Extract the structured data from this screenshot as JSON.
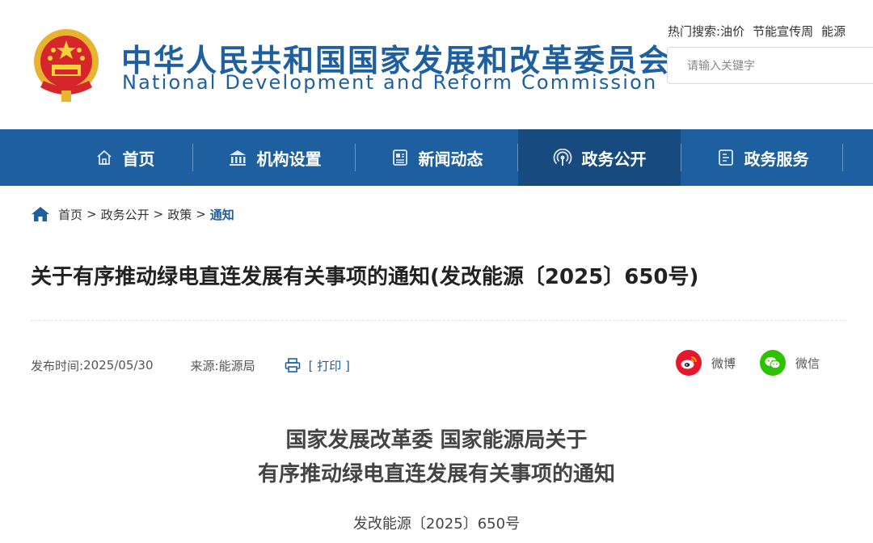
{
  "header": {
    "org_name_cn": "中华人民共和国国家发展和改革委员会",
    "org_name_en": "National Development and Reform Commission",
    "hot_search_label": "热门搜索:",
    "hot_search_terms": [
      "油价",
      "节能宣传周",
      "能源"
    ],
    "search_placeholder": "请输入关键字"
  },
  "nav": {
    "items": [
      {
        "label": "首页",
        "icon": "home-icon"
      },
      {
        "label": "机构设置",
        "icon": "building-icon"
      },
      {
        "label": "新闻动态",
        "icon": "news-icon"
      },
      {
        "label": "政务公开",
        "icon": "broadcast-icon",
        "active": true
      },
      {
        "label": "政务服务",
        "icon": "service-icon"
      }
    ]
  },
  "breadcrumb": {
    "items": [
      "首页",
      "政务公开",
      "政策"
    ],
    "separator": ">",
    "current": "通知"
  },
  "article": {
    "title": "关于有序推动绿电直连发展有关事项的通知(发改能源〔2025〕650号)",
    "publish_label": "发布时间:",
    "publish_date": "2025/05/30",
    "source_label": "来源:",
    "source": "能源局",
    "print_label": "[ 打印 ]",
    "share": {
      "weibo": "微博",
      "wechat": "微信"
    },
    "body_title_line1": "国家发展改革委 国家能源局关于",
    "body_title_line2": "有序推动绿电直连发展有关事项的通知",
    "doc_number": "发改能源〔2025〕650号"
  },
  "colors": {
    "brand_blue": "#1d5f9f",
    "nav_active": "#174b80",
    "weibo_red": "#e6162d",
    "wechat_green": "#2dc100"
  }
}
